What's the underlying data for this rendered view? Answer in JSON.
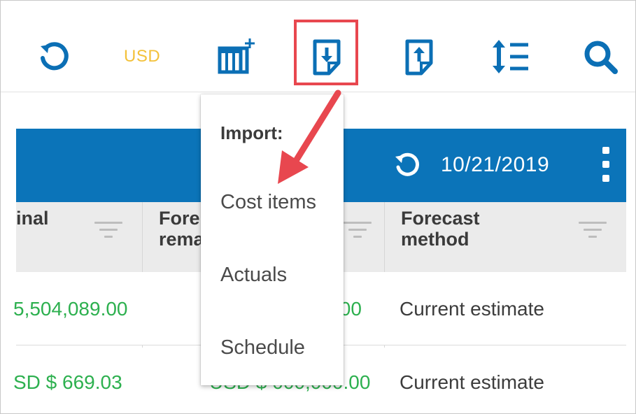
{
  "toolbar": {
    "currency": "USD",
    "icons": [
      "refresh-icon",
      "add-column-icon",
      "import-icon",
      "export-icon",
      "sort-icon",
      "search-icon"
    ],
    "accent_color": "#0b6fb5",
    "highlight_color": "#e8474f"
  },
  "band": {
    "date": "10/21/2019",
    "color": "#0b74b9"
  },
  "columns": [
    {
      "label": "inal"
    },
    {
      "label": "Fore\nrema"
    },
    {
      "label": "Forecast\nmethod"
    }
  ],
  "rows": [
    {
      "original": "5,504,089.00",
      "forecast_remaining": ".00",
      "forecast_method": "Current estimate"
    },
    {
      "original": "SD $ 669.03",
      "forecast_remaining": "USD $ 000,000.00",
      "forecast_method": "Current estimate"
    }
  ],
  "dropdown": {
    "title": "Import:",
    "items": [
      "Cost items",
      "Actuals",
      "Schedule"
    ]
  }
}
